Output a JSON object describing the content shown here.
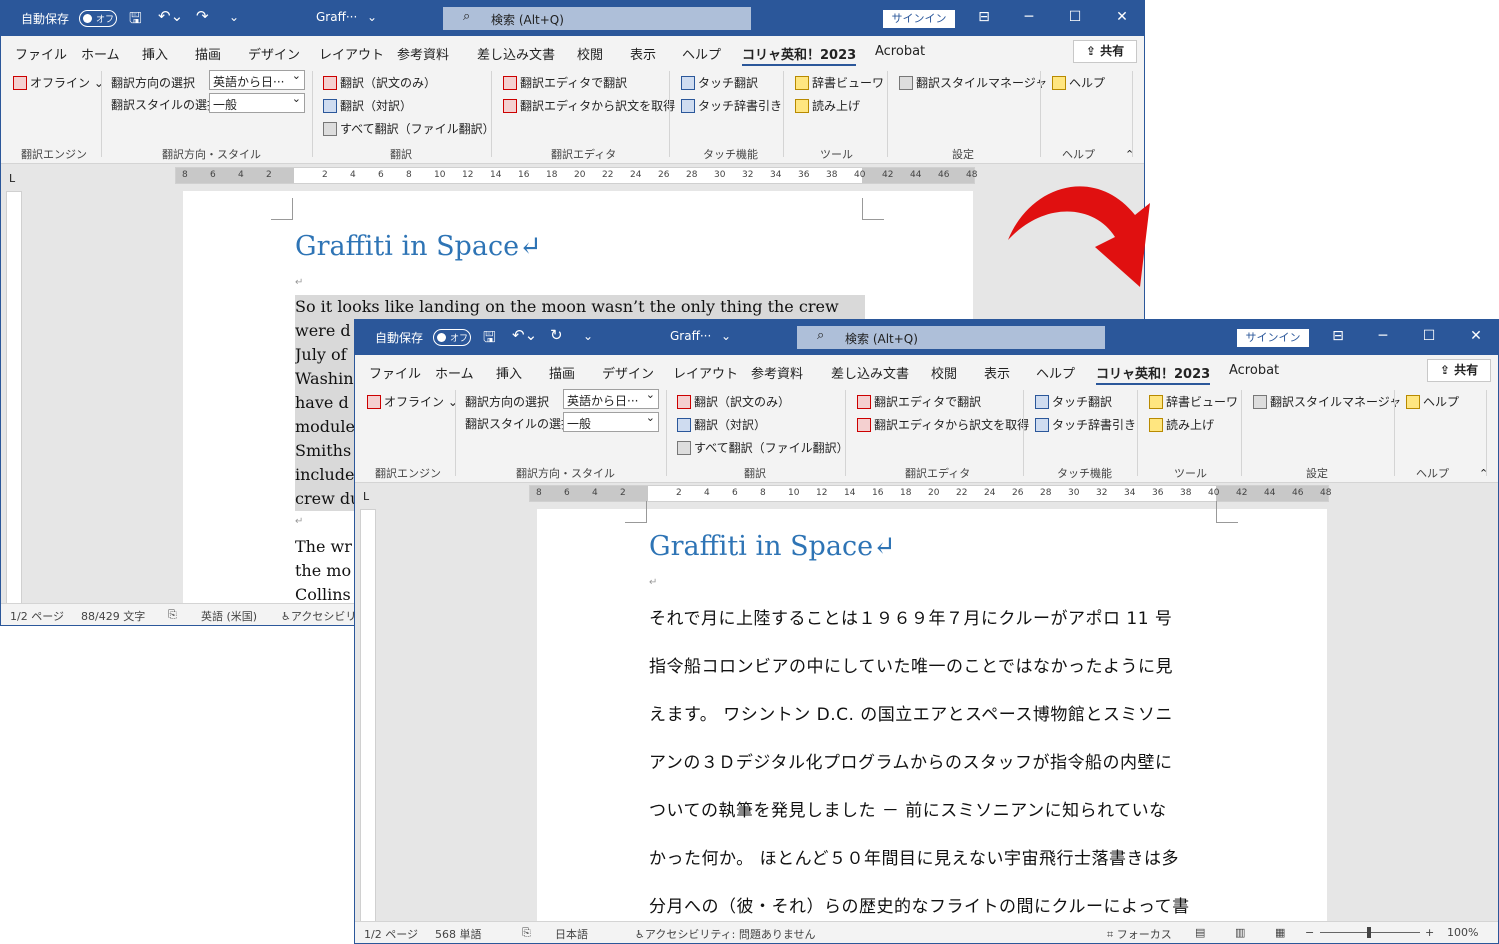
{
  "windows": [
    {
      "title": "Graff···",
      "autosave_label": "自動保存",
      "autosave_state": "オフ",
      "search_text": "検索 (Alt+Q)",
      "signin": "サインイン",
      "tabs": [
        "ファイル",
        "ホーム",
        "挿入",
        "描画",
        "デザイン",
        "レイアウト",
        "参考資料",
        "差し込み文書",
        "校閲",
        "表示",
        "ヘルプ",
        "コリャ英和！2023",
        "Acrobat"
      ],
      "share": "共有",
      "ribbon": {
        "offline": "オフライン",
        "dir_label": "翻訳方向の選択",
        "dir_value": "英語から日···",
        "style_label": "翻訳スタイルの選択",
        "style_value": "一般",
        "tr_only": "翻訳（訳文のみ）",
        "tr_pair": "翻訳（対訳）",
        "tr_all": "すべて翻訳（ファイル翻訳）",
        "ed_tr": "翻訳エディタで翻訳",
        "ed_get": "翻訳エディタから訳文を取得",
        "touch_tr": "タッチ翻訳",
        "touch_dict": "タッチ辞書引き",
        "dict_view": "辞書ビューワ",
        "read": "読み上げ",
        "style_mgr": "翻訳スタイルマネージャ",
        "help": "ヘルプ",
        "groups": [
          "翻訳エンジン",
          "翻訳方向・スタイル",
          "翻訳",
          "翻訳エディタ",
          "タッチ機能",
          "ツール",
          "設定",
          "ヘルプ"
        ]
      },
      "doc_title": "Graffiti in Space↵",
      "para_lines": [
        "So it looks like landing on the moon wasn’t the only thing the crew",
        "were d",
        "July of",
        "Washin",
        "have d",
        "module",
        "Smiths",
        "include",
        "crew du"
      ],
      "para2_lines": [
        "The wr",
        "the mo",
        "Collins"
      ],
      "status": [
        "1/2 ページ",
        "88/429 文字",
        "英語 (米国)",
        "アクセシビリテ"
      ]
    },
    {
      "title": "Graff···",
      "autosave_label": "自動保存",
      "autosave_state": "オフ",
      "search_text": "検索 (Alt+Q)",
      "signin": "サインイン",
      "tabs": [
        "ファイル",
        "ホーム",
        "挿入",
        "描画",
        "デザイン",
        "レイアウト",
        "参考資料",
        "差し込み文書",
        "校閲",
        "表示",
        "ヘルプ",
        "コリャ英和！2023",
        "Acrobat"
      ],
      "share": "共有",
      "ribbon": {
        "offline": "オフライン",
        "dir_label": "翻訳方向の選択",
        "dir_value": "英語から日···",
        "style_label": "翻訳スタイルの選択",
        "style_value": "一般",
        "tr_only": "翻訳（訳文のみ）",
        "tr_pair": "翻訳（対訳）",
        "tr_all": "すべて翻訳（ファイル翻訳）",
        "ed_tr": "翻訳エディタで翻訳",
        "ed_get": "翻訳エディタから訳文を取得",
        "touch_tr": "タッチ翻訳",
        "touch_dict": "タッチ辞書引き",
        "dict_view": "辞書ビューワ",
        "read": "読み上げ",
        "style_mgr": "翻訳スタイルマネージャ",
        "help": "ヘルプ",
        "groups": [
          "翻訳エンジン",
          "翻訳方向・スタイル",
          "翻訳",
          "翻訳エディタ",
          "タッチ機能",
          "ツール",
          "設定",
          "ヘルプ"
        ]
      },
      "doc_title": "Graffiti in Space↵",
      "jp_lines": [
        "それで月に上陸することは１９６９年７月にクルーがアポロ 11 号",
        "指令船コロンビアの中にしていた唯一のことではなかったように見",
        "えます。 ワシントン D.C. の国立エアとスペース博物館とスミソニ",
        "アンの３Ｄデジタル化プログラムからのスタッフが指令船の内壁に",
        "ついての執筆を発見しました － 前にスミソニアンに知られていな",
        "かった何か。 ほとんど５０年間目に見えない宇宙飛行士落書きは多",
        "分月への（彼・それ）らの歴史的なフライトの間にクルーによって書"
      ],
      "status": [
        "1/2 ページ",
        "568 単語",
        "日本語",
        "アクセシビリティ: 問題ありません",
        "フォーカス",
        "100%"
      ]
    }
  ],
  "ruler_numbers": [
    "8",
    "6",
    "4",
    "2",
    "2",
    "4",
    "6",
    "8",
    "10",
    "12",
    "14",
    "16",
    "18",
    "20",
    "22",
    "24",
    "26",
    "28",
    "30",
    "32",
    "34",
    "36",
    "38",
    "40",
    "42",
    "44",
    "46",
    "48"
  ],
  "colors": {
    "titlebar": "#2b579a",
    "arrow": "#e01010",
    "heading": "#2e74b5"
  }
}
